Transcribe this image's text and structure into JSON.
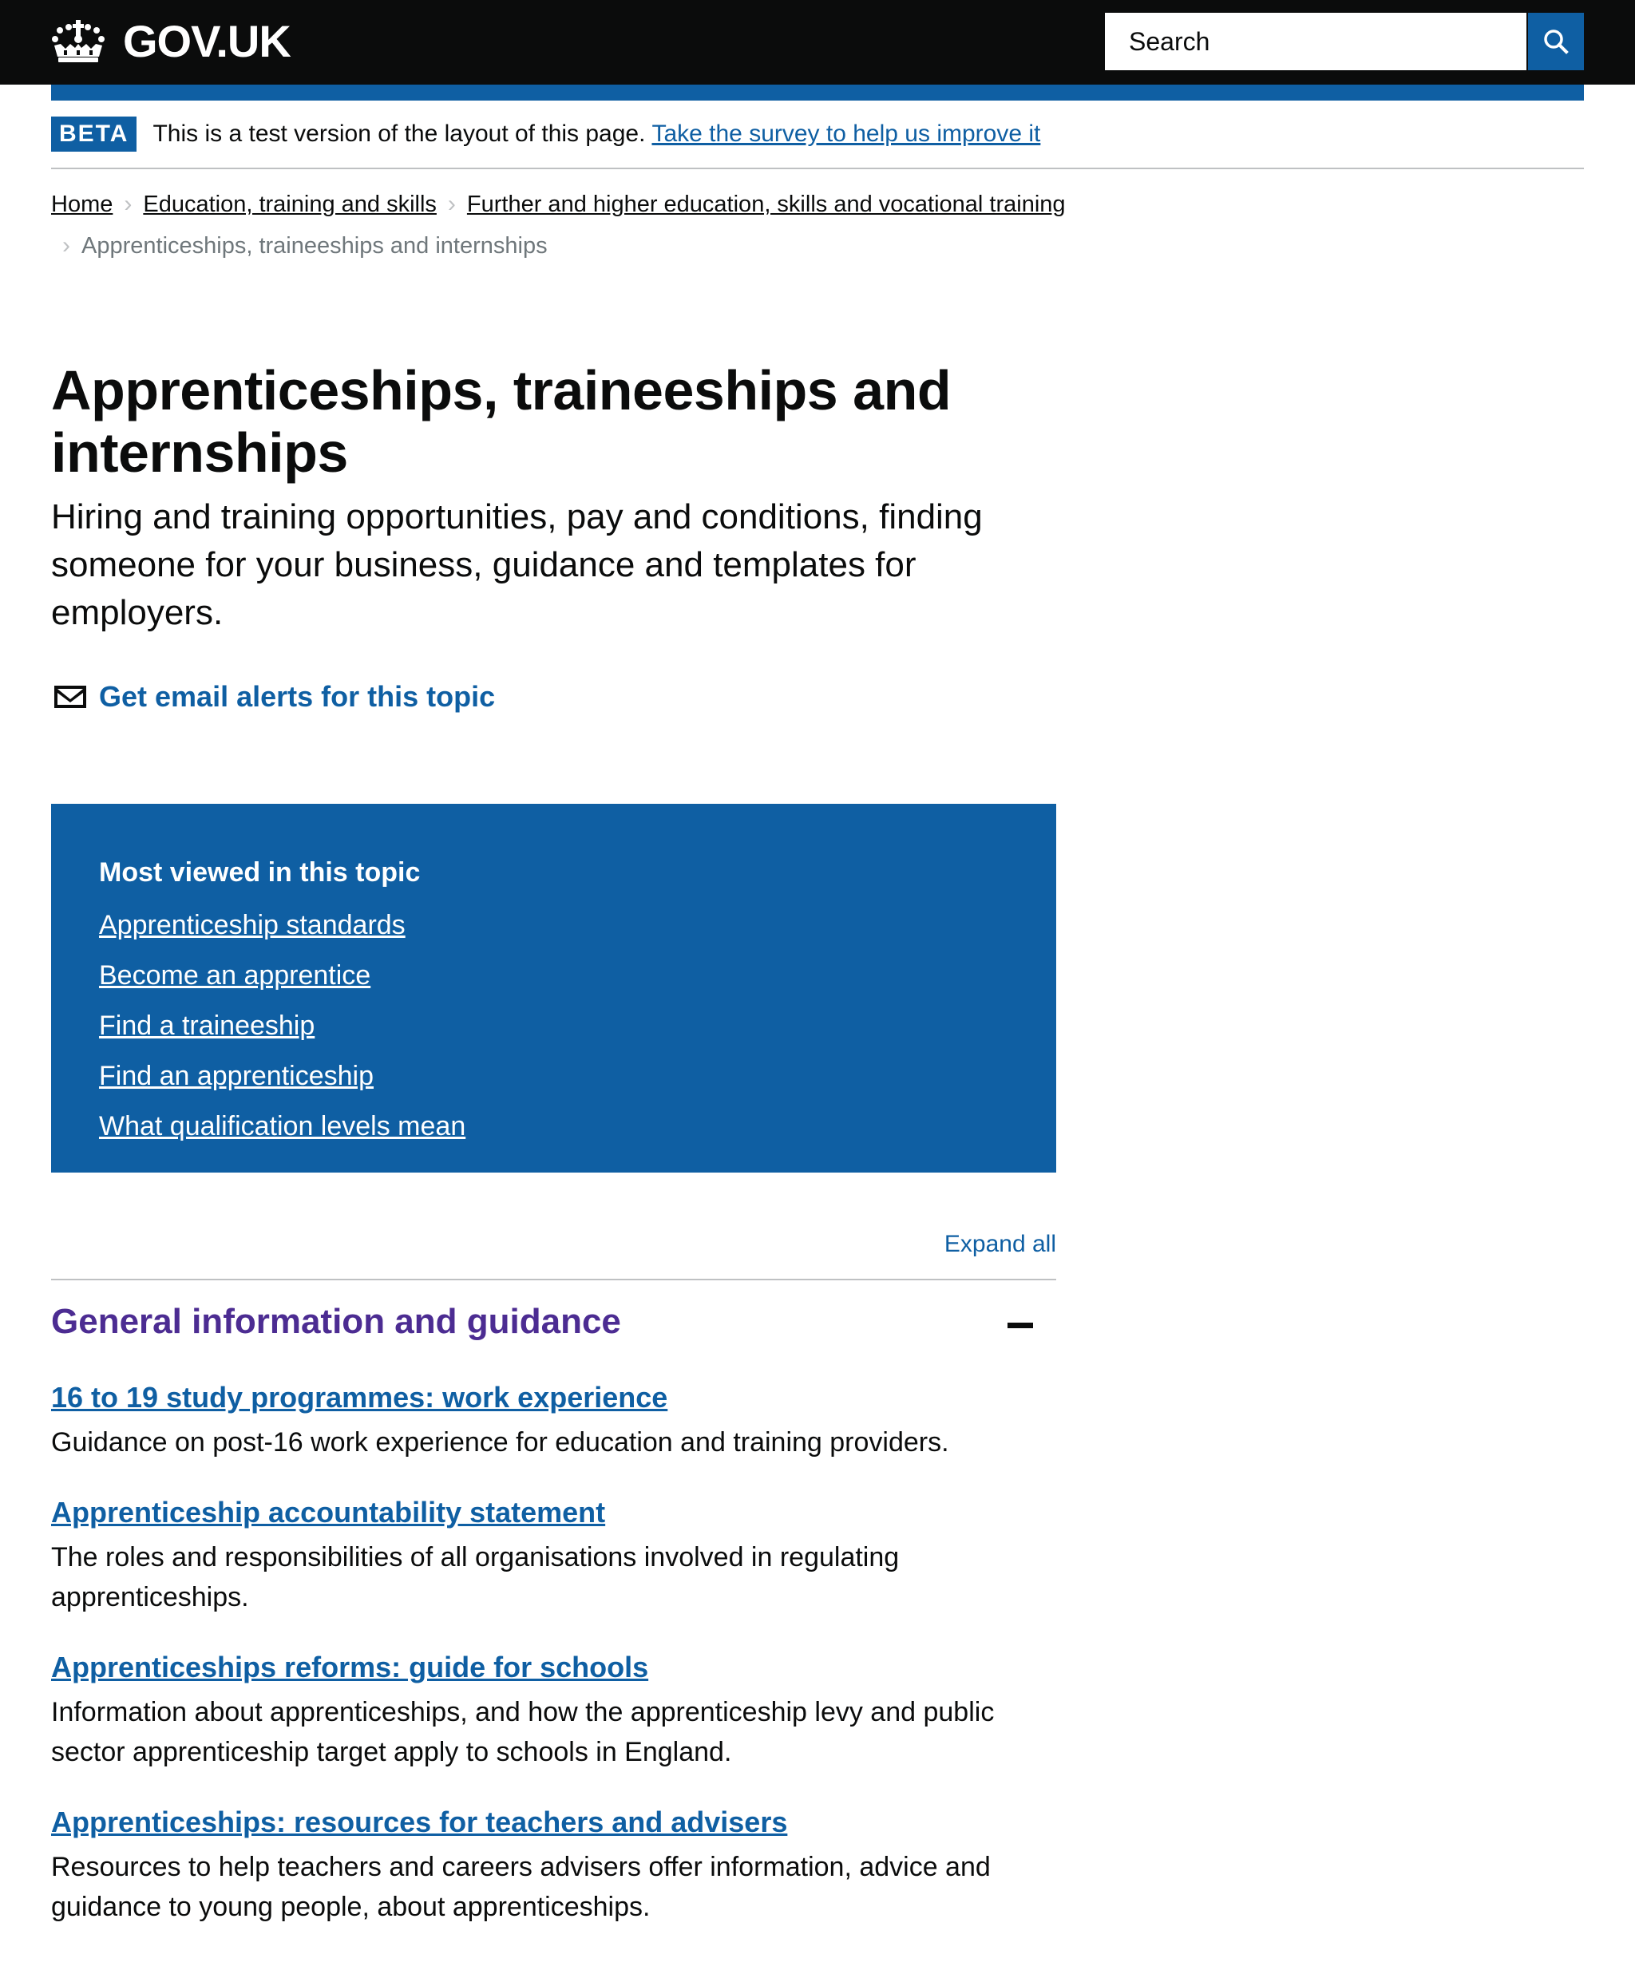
{
  "header": {
    "logo_text": "GOV.UK",
    "search_placeholder": "Search",
    "search_button_label": "Search"
  },
  "beta_banner": {
    "tag": "BETA",
    "text": "This is a test version of the layout of this page.",
    "link": "Take the survey to help us improve it"
  },
  "breadcrumbs": {
    "items": [
      {
        "label": "Home"
      },
      {
        "label": "Education, training and skills"
      },
      {
        "label": "Further and higher education, skills and vocational training"
      }
    ],
    "current": "Apprenticeships, traineeships and internships"
  },
  "page": {
    "title": "Apprenticeships, traineeships and internships",
    "description": "Hiring and training opportunities, pay and conditions, finding someone for your business, guidance and templates for employers.",
    "email_alerts": "Get email alerts for this topic"
  },
  "most_viewed": {
    "title": "Most viewed in this topic",
    "links": [
      "Apprenticeship standards",
      "Become an apprentice",
      "Find a traineeship",
      "Find an apprenticeship",
      "What qualification levels mean"
    ]
  },
  "accordion": {
    "expand_all": "Expand all",
    "section": {
      "title": "General information and guidance",
      "expanded": true,
      "items": [
        {
          "title": "16 to 19 study programmes: work experience",
          "description": "Guidance on post-16 work experience for education and training providers."
        },
        {
          "title": "Apprenticeship accountability statement",
          "description": "The roles and responsibilities of all organisations involved in regulating apprenticeships."
        },
        {
          "title": "Apprenticeships reforms: guide for schools",
          "description": "Information about apprenticeships, and how the apprenticeship levy and public sector apprenticeship target apply to schools in England."
        },
        {
          "title": "Apprenticeships: resources for teachers and advisers",
          "description": "Resources to help teachers and careers advisers offer information, advice and guidance to young people, about apprenticeships."
        }
      ]
    }
  },
  "colors": {
    "header_bg": "#0b0c0c",
    "brand_blue": "#0f5fa3",
    "visited_purple": "#4c2c92",
    "text": "#0b0c0c",
    "secondary_text": "#6f777b",
    "border": "#bfc1c3"
  },
  "icons": {
    "logo": "crown-icon",
    "search": "search-icon",
    "email": "envelope-icon",
    "breadcrumb_separator": "chevron-right-icon",
    "collapse": "minus-icon"
  }
}
